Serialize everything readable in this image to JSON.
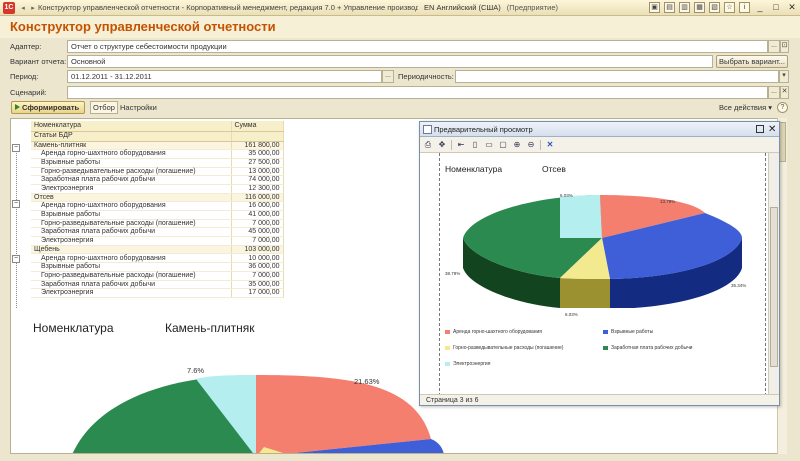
{
  "window": {
    "title": "Конструктор управленческой отчетности - Корпоративный менеджмент, редакция 7.0 + Управление производственным п",
    "lang": "EN Английский (США)",
    "mode": "(Предприятие)"
  },
  "form": {
    "title": "Конструктор управленческой отчетности",
    "adapter_label": "Адаптер:",
    "adapter_value": "Отчет о структуре себестоимости продукции",
    "variant_label": "Вариант отчета:",
    "variant_value": "Основной",
    "variant_button": "Выбрать вариант...",
    "period_label": "Период:",
    "period_value": "01.12.2011 - 31.12.2011",
    "periodicity_label": "Периодичность:",
    "periodicity_value": "",
    "scenario_label": "Сценарий:",
    "scenario_value": ""
  },
  "toolbar": {
    "run_label": "Сформировать",
    "filter_label": "Отбор",
    "settings_label": "Настройки",
    "all_actions_label": "Все действия ▾",
    "help_label": "?"
  },
  "report": {
    "headers": [
      "Номенклатура",
      "Сумма"
    ],
    "subheader": "Статьи БДР",
    "groups": [
      {
        "name": "Камень-плитняк",
        "total": "161 800,00",
        "rows": [
          {
            "name": "Аренда горно-шахтного оборудования",
            "value": "35 000,00"
          },
          {
            "name": "Взрывные работы",
            "value": "27 500,00"
          },
          {
            "name": "Горно-разведывательные расходы (погашение)",
            "value": "13 000,00"
          },
          {
            "name": "Заработная плата рабочих добычи",
            "value": "74 000,00"
          },
          {
            "name": "Электроэнергия",
            "value": "12 300,00"
          }
        ]
      },
      {
        "name": "Отсев",
        "total": "116 000,00",
        "rows": [
          {
            "name": "Аренда горно-шахтного оборудования",
            "value": "16 000,00"
          },
          {
            "name": "Взрывные работы",
            "value": "41 000,00"
          },
          {
            "name": "Горно-разведывательные расходы (погашение)",
            "value": "7 000,00"
          },
          {
            "name": "Заработная плата рабочих добычи",
            "value": "45 000,00"
          },
          {
            "name": "Электроэнергия",
            "value": "7 000,00"
          }
        ]
      },
      {
        "name": "Щебень",
        "total": "103 000,00",
        "rows": [
          {
            "name": "Аренда горно-шахтного оборудования",
            "value": "10 000,00"
          },
          {
            "name": "Взрывные работы",
            "value": "36 000,00"
          },
          {
            "name": "Горно-разведывательные расходы (погашение)",
            "value": "7 000,00"
          },
          {
            "name": "Заработная плата рабочих добычи",
            "value": "35 000,00"
          },
          {
            "name": "Электроэнергия",
            "value": "17 000,00"
          }
        ]
      }
    ]
  },
  "chart_main": {
    "heading": "Номенклатура",
    "group": "Камень-плитняк",
    "label_a": "21.63%",
    "label_b": "7.6%"
  },
  "preview": {
    "title": "Предварительный просмотр",
    "chart_heading": "Номенклатура",
    "chart_group": "Отсев",
    "labels": [
      "13.79%",
      "35.34%",
      "6.03%",
      "38.79%",
      "6.03%"
    ],
    "legend": [
      {
        "name": "Аренда горно-шахтного оборудования",
        "color": "#f47f6f"
      },
      {
        "name": "Взрывные работы",
        "color": "#3f5fd8"
      },
      {
        "name": "Горно-разведывательные расходы (погашение)",
        "color": "#f3e98e"
      },
      {
        "name": "Заработная плата рабочих добычи",
        "color": "#2b8a4f"
      },
      {
        "name": "Электроэнергия",
        "color": "#b4eeee"
      }
    ],
    "status": "Страница 3 из 6"
  },
  "colors": {
    "accent": "#c55200",
    "slice_rent": "#f47f6f",
    "slice_blast": "#3f5fd8",
    "slice_geo": "#f3e98e",
    "slice_wage": "#2b8a4f",
    "slice_power": "#b4eeee"
  }
}
